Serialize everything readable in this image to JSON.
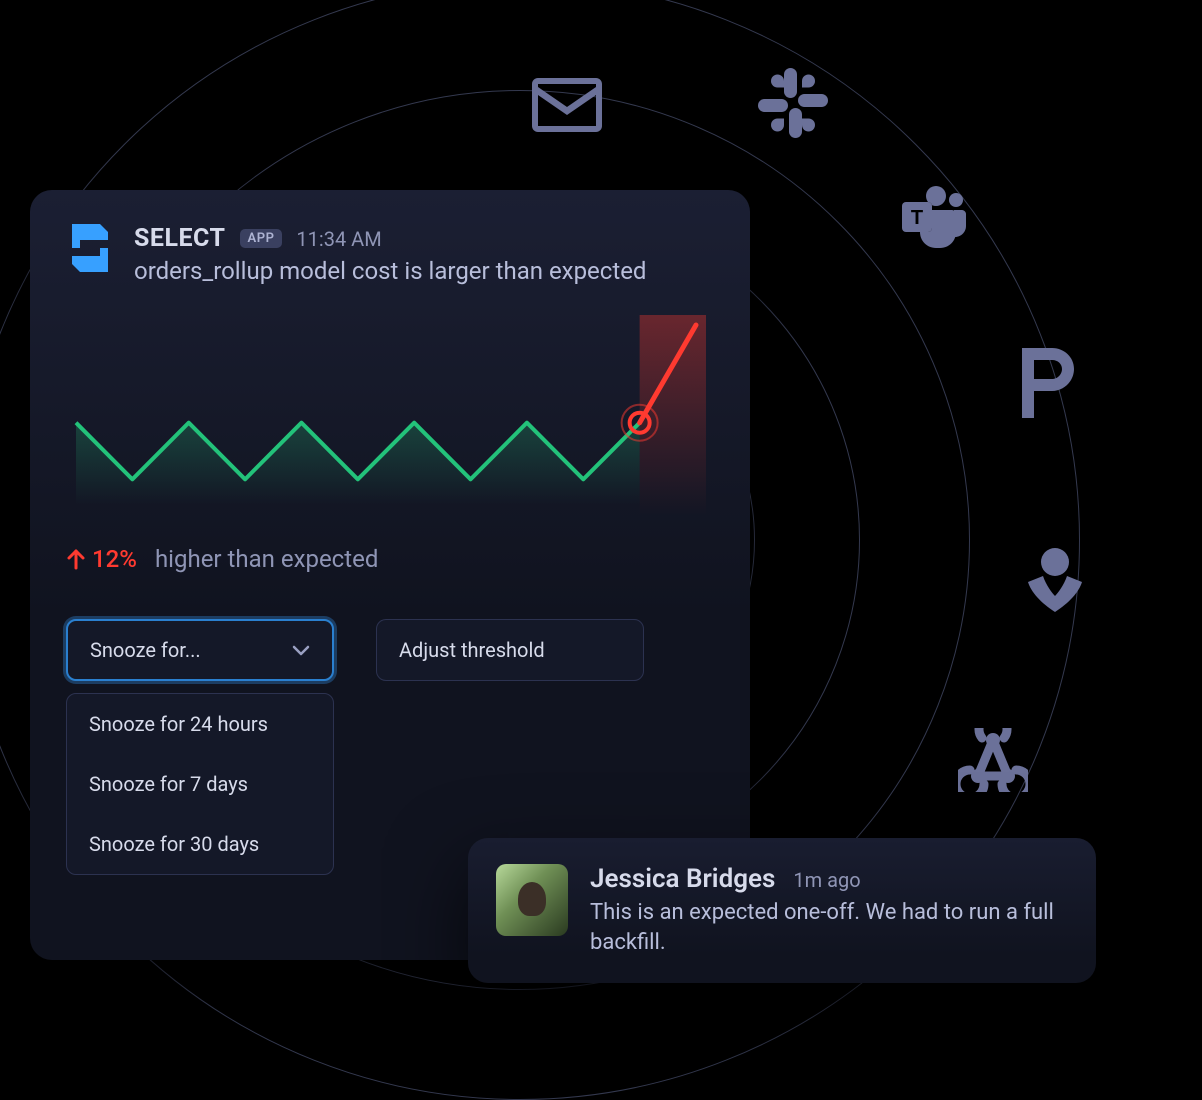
{
  "app": {
    "name": "SELECT",
    "badge": "APP",
    "timestamp": "11:34 AM"
  },
  "alert": {
    "title": "orders_rollup model cost is larger than expected",
    "delta_pct": "12%",
    "delta_direction": "up",
    "delta_text": "higher than expected"
  },
  "actions": {
    "snooze_placeholder": "Snooze for...",
    "adjust_label": "Adjust threshold",
    "snooze_options": [
      "Snooze for 24 hours",
      "Snooze for 7 days",
      "Snooze for 30 days"
    ]
  },
  "reply": {
    "name": "Jessica Bridges",
    "ago": "1m ago",
    "body": "This is an expected one-off. We had to run a full backfill."
  },
  "destinations": {
    "mail": "mail-icon",
    "slack": "slack-icon",
    "teams": "teams-icon",
    "pagerduty": "pagerduty-icon",
    "opsgenie": "opsgenie-icon",
    "webhook": "webhook-icon"
  },
  "colors": {
    "green": "#23c27a",
    "red": "#ff3a30",
    "accent": "#37a0ff",
    "icon": "#6b7199"
  },
  "chart_data": {
    "type": "line",
    "title": "",
    "xlabel": "",
    "ylabel": "",
    "xlim": [
      0,
      11
    ],
    "ylim": [
      0,
      140
    ],
    "series": [
      {
        "name": "cost",
        "x": [
          0,
          1,
          2,
          3,
          4,
          5,
          6,
          7,
          8,
          9,
          10,
          11
        ],
        "values": [
          64,
          20,
          64,
          20,
          64,
          20,
          64,
          20,
          64,
          20,
          64,
          140
        ],
        "color": "#23c27a"
      }
    ],
    "anomaly_start_index": 10,
    "anomaly_point_index": 10,
    "anomaly_color": "#ff3a30"
  }
}
